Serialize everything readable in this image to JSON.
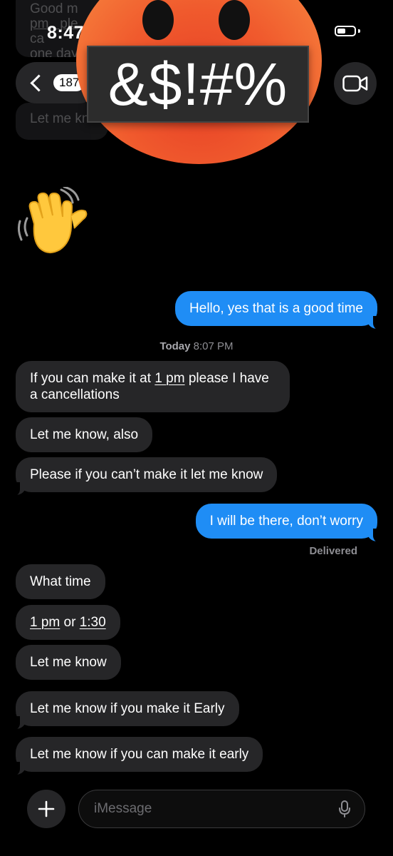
{
  "status_bar": {
    "time": "8:47"
  },
  "header": {
    "back_count": "187"
  },
  "overlay_ghost": {
    "lines": [
      "Good m",
      "pm , ple",
      "ca",
      "one day"
    ],
    "preview": "Let me kn"
  },
  "sticker": {
    "text": "&$!#%",
    "icon": "angry-face-icon"
  },
  "conversation": {
    "timestamp_day": "Today",
    "timestamp_time": "8:07 PM",
    "delivered_label": "Delivered"
  },
  "messages": {
    "m1": "Hello, yes that is a good time",
    "m2_pre": "If you can make it at ",
    "m2_link": "1 pm",
    "m2_post": " please I have",
    "m2_line2": "a cancellations",
    "m3": "Let me know, also",
    "m4": "Please if you can’t make it let me know",
    "m5": "I will be there, don’t worry",
    "m6": "What time",
    "m7_link1": "1 pm",
    "m7_mid": " or ",
    "m7_link2": "1:30",
    "m8": "Let me know",
    "m9": "Let me know if you make it Early",
    "m10": "Let me know if you can make it early"
  },
  "composer": {
    "placeholder": "iMessage"
  },
  "colors": {
    "outgoing": "#1f8df5",
    "incoming": "#262628",
    "background": "#000000"
  }
}
